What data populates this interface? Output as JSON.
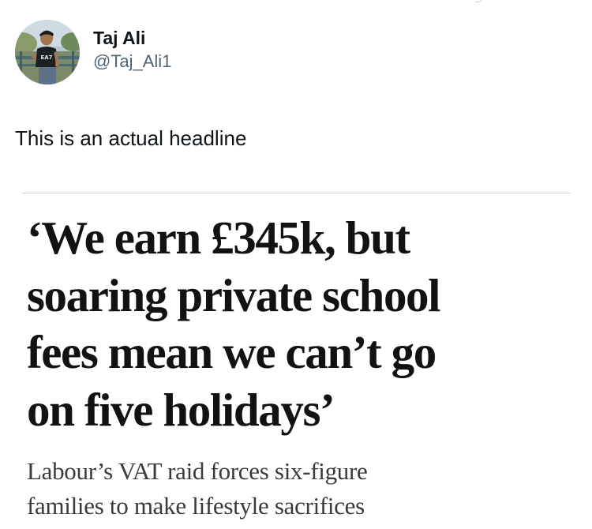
{
  "tweet": {
    "author": {
      "display_name": "Taj Ali",
      "handle": "@Taj_Ali1",
      "avatar": "profile-photo"
    },
    "text": "This is an actual headline",
    "media": {
      "headline_lines": [
        "‘We earn £345k, but",
        "soaring private school",
        "fees mean we can’t go",
        "on five holidays’"
      ],
      "standfirst_lines": [
        "Labour’s VAT raid forces six-figure",
        "families to make lifestyle sacrifices"
      ],
      "shirt_print": "EA7"
    }
  }
}
